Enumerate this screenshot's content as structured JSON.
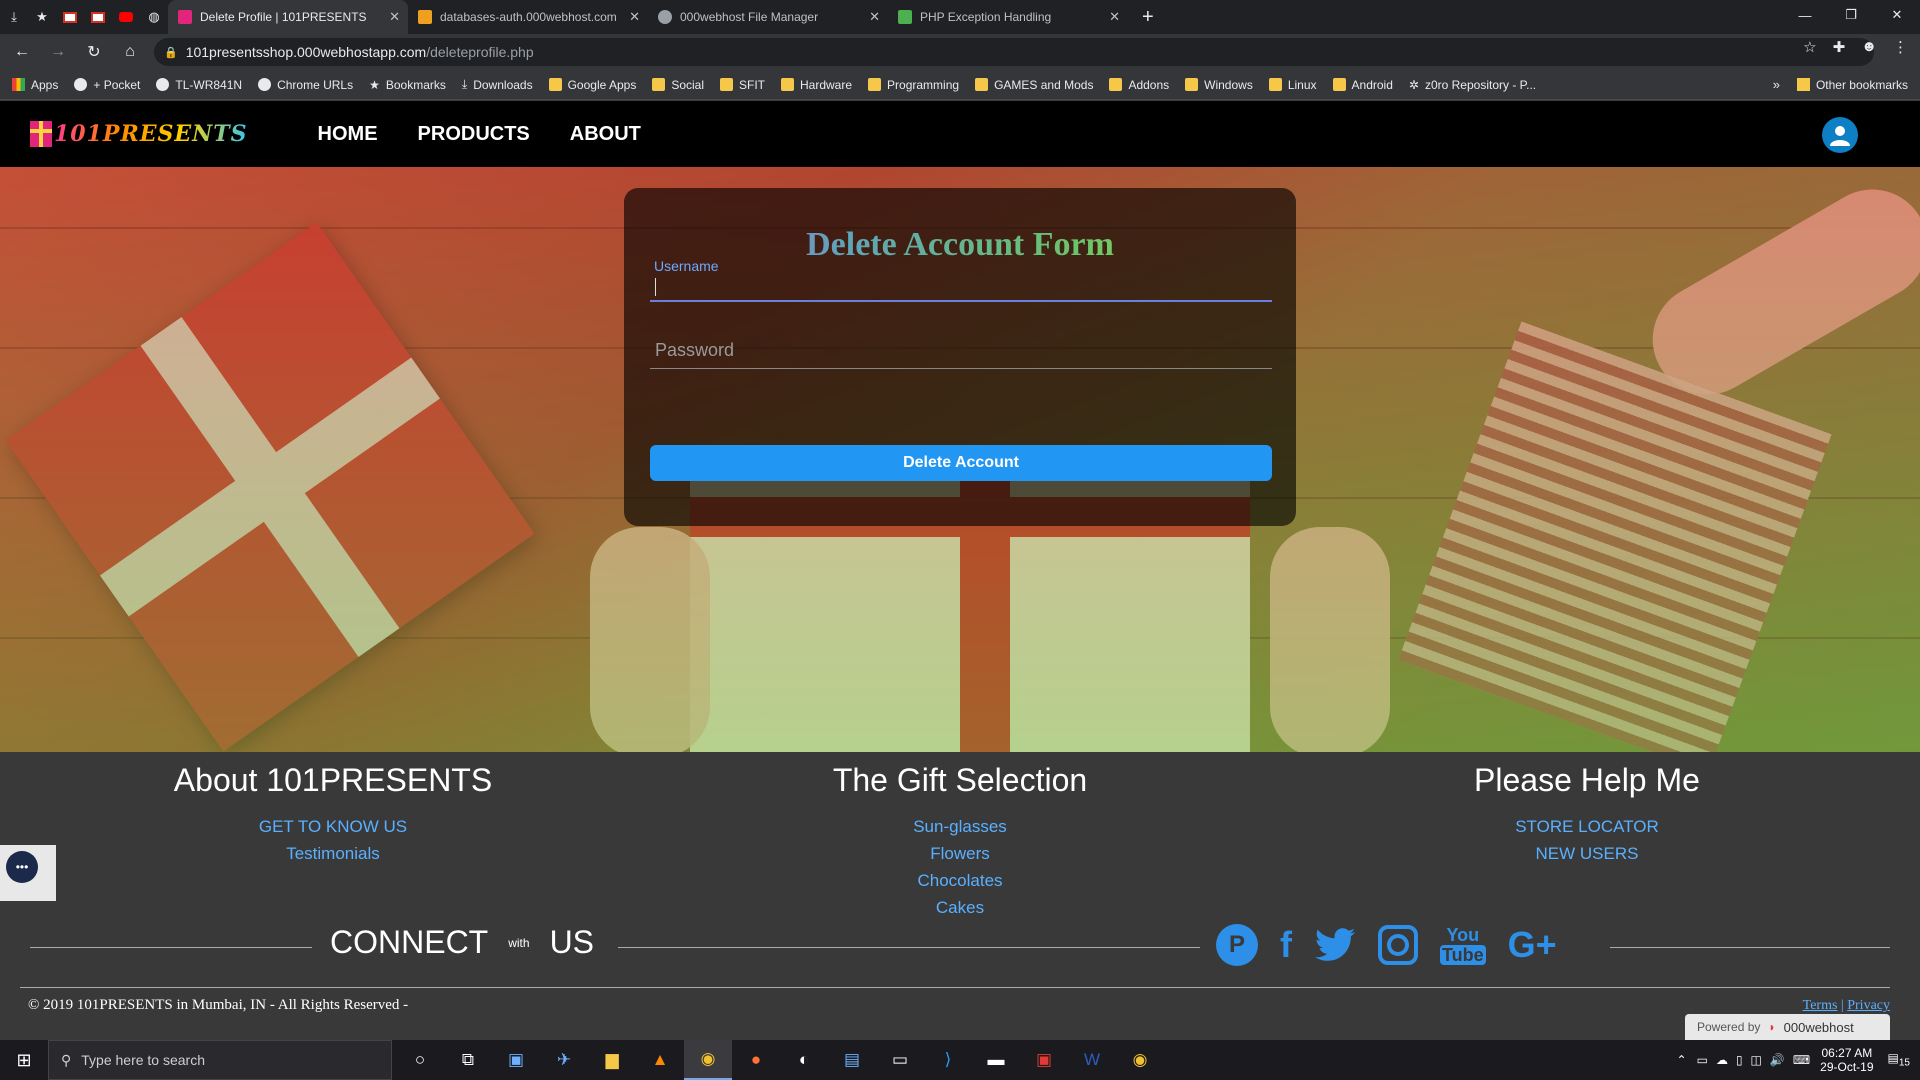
{
  "browser": {
    "tabs": [
      {
        "title": "Delete Profile | 101PRESENTS",
        "active": true,
        "color": "#e0257a"
      },
      {
        "title": "databases-auth.000webhost.com",
        "active": false,
        "color": "#f0a020"
      },
      {
        "title": "000webhost File Manager",
        "active": false,
        "color": "#9aa0a6"
      },
      {
        "title": "PHP Exception Handling",
        "active": false,
        "color": "#4caf50"
      }
    ],
    "url_host": "101presentsshop.000webhostapp.com",
    "url_path": "/deleteprofile.php",
    "bookmarks": [
      {
        "label": "Apps",
        "icon": "apps-grid-icon"
      },
      {
        "label": "+ Pocket",
        "icon": "globe-icon"
      },
      {
        "label": "TL-WR841N",
        "icon": "globe-icon"
      },
      {
        "label": "Chrome URLs",
        "icon": "globe-icon"
      },
      {
        "label": "Bookmarks",
        "icon": "star-icon"
      },
      {
        "label": "Downloads",
        "icon": "download-icon"
      },
      {
        "label": "Google Apps",
        "icon": "folder-icon"
      },
      {
        "label": "Social",
        "icon": "folder-icon"
      },
      {
        "label": "SFIT",
        "icon": "folder-icon"
      },
      {
        "label": "Hardware",
        "icon": "folder-icon"
      },
      {
        "label": "Programming",
        "icon": "folder-icon"
      },
      {
        "label": "GAMES and Mods",
        "icon": "folder-icon"
      },
      {
        "label": "Addons",
        "icon": "folder-icon"
      },
      {
        "label": "Windows",
        "icon": "folder-icon"
      },
      {
        "label": "Linux",
        "icon": "folder-icon"
      },
      {
        "label": "Android",
        "icon": "folder-icon"
      },
      {
        "label": "z0ro Repository - P...",
        "icon": "bug-icon"
      }
    ],
    "bookmarks_more": "»",
    "other_bookmarks": "Other bookmarks"
  },
  "site": {
    "logo_text": "101PRESENTS",
    "nav": [
      "HOME",
      "PRODUCTS",
      "ABOUT"
    ],
    "form": {
      "title": "Delete Account Form",
      "username_label": "Username",
      "password_placeholder": "Password",
      "submit_label": "Delete Account"
    },
    "footer": {
      "col1": {
        "title": "About 101PRESENTS",
        "links": [
          "GET TO KNOW US",
          "Testimonials"
        ]
      },
      "col2": {
        "title": "The Gift Selection",
        "links": [
          "Sun-glasses",
          "Flowers",
          "Chocolates",
          "Cakes"
        ]
      },
      "col3": {
        "title": "Please Help Me",
        "links": [
          "STORE LOCATOR",
          "NEW USERS"
        ]
      },
      "connect": "CONNECT",
      "with": "with",
      "us": "US",
      "socials": [
        "pinterest-icon",
        "facebook-icon",
        "twitter-icon",
        "instagram-icon",
        "youtube-icon",
        "google-plus-icon"
      ],
      "copyright": "© 2019 101PRESENTS in Mumbai, IN - All Rights Reserved -",
      "terms": "Terms",
      "privacy": "Privacy",
      "powered_by": "Powered by",
      "host": "000webhost"
    }
  },
  "taskbar": {
    "search_placeholder": "Type here to search",
    "time": "06:27 AM",
    "date": "29-Oct-19",
    "notifications": "15"
  }
}
